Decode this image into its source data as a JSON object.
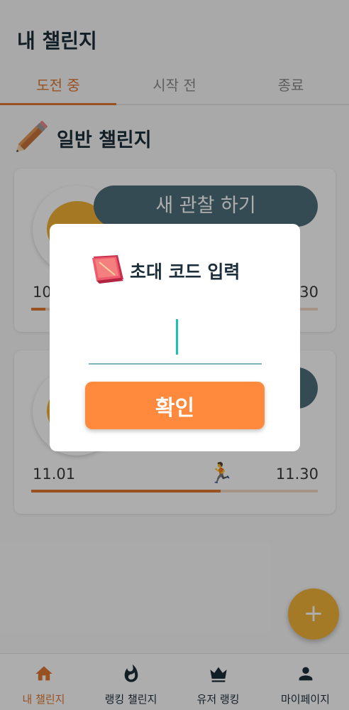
{
  "header": {
    "title": "내 챌린지"
  },
  "tabs": [
    {
      "label": "도전 중",
      "active": true
    },
    {
      "label": "시작 전",
      "active": false
    },
    {
      "label": "종료",
      "active": false
    }
  ],
  "section": {
    "title": "일반 챌린지",
    "icon": "pencil-icon"
  },
  "cards": [
    {
      "action_label": "새 관찰 하기",
      "start_date": "10",
      "end_date": "30",
      "progress": 0.05
    },
    {
      "action_label": "",
      "start_date": "11.01",
      "end_date": "11.30",
      "progress": 0.66
    }
  ],
  "dialog": {
    "icon": "notebook-icon",
    "title": "초대 코드 입력",
    "input_value": "",
    "input_placeholder": "",
    "confirm_label": "확인"
  },
  "fab": {
    "label": "+"
  },
  "bottom_nav": [
    {
      "label": "내 챌린지",
      "icon": "home-icon",
      "active": true
    },
    {
      "label": "랭킹 챌린지",
      "icon": "fire-icon",
      "active": false
    },
    {
      "label": "유저 랭킹",
      "icon": "crown-icon",
      "active": false
    },
    {
      "label": "마이페이지",
      "icon": "person-icon",
      "active": false
    }
  ],
  "colors": {
    "accent": "#e07a32",
    "confirm": "#ff8a3d",
    "fab": "#f3b43a",
    "pill": "#4f6f7d",
    "caret": "#1bbfba"
  }
}
